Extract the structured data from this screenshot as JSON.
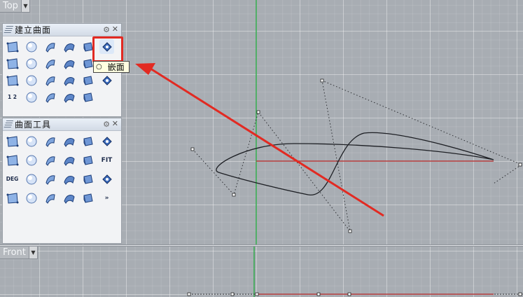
{
  "viewports": {
    "top": {
      "name": "Top"
    },
    "front": {
      "name": "Front"
    }
  },
  "panels": {
    "create_surface": {
      "title": "建立曲面",
      "highlighted_tool": "loft-tool"
    },
    "surface_tools": {
      "title": "曲面工具"
    }
  },
  "tooltip": {
    "text": "嵌面"
  },
  "colors": {
    "annotation": "#e22a22",
    "x_axis": "#b23a3a",
    "y_axis": "#2fa84a",
    "curve": "#1d1f24"
  },
  "icons": {
    "create_surface": [
      "surface-from-points-icon",
      "sphere-icon",
      "loft-tool-icon",
      "sweep-icon",
      "extrude-icon",
      "patch-icon",
      "plane-icon",
      "rectangle-surface-icon",
      "edge-surface-icon",
      "network-surface-icon",
      "rail-surface-icon",
      "",
      "box-icon",
      "cylinder-icon",
      "cone-icon",
      "pyramid-icon",
      "tube-icon",
      "revolve-icon",
      "curve-1-2-icon",
      "blend-icon",
      "drape-icon",
      "heightfield-icon",
      "point-grid-icon",
      ""
    ],
    "surface_tools": [
      "extend-icon",
      "fillet-icon",
      "chamfer-icon",
      "offset-icon",
      "blend-surface-icon",
      "match-icon",
      "merge-icon",
      "rebuild-icon",
      "shrink-icon",
      "split-icon",
      "check-icon",
      "fit-icon",
      "degree-icon",
      "uv-icon",
      "edge-tool-icon",
      "unroll-icon",
      "analysis-icon",
      "more-icon",
      "point-on-icon",
      "solid-icon",
      "surface-edit-icon",
      "knife-icon",
      "gumball-icon",
      "overflow-icon"
    ]
  },
  "tool_labels": {
    "fit": "FIT",
    "deg": "DEG",
    "overflow": "»",
    "tool12": "1 2"
  }
}
